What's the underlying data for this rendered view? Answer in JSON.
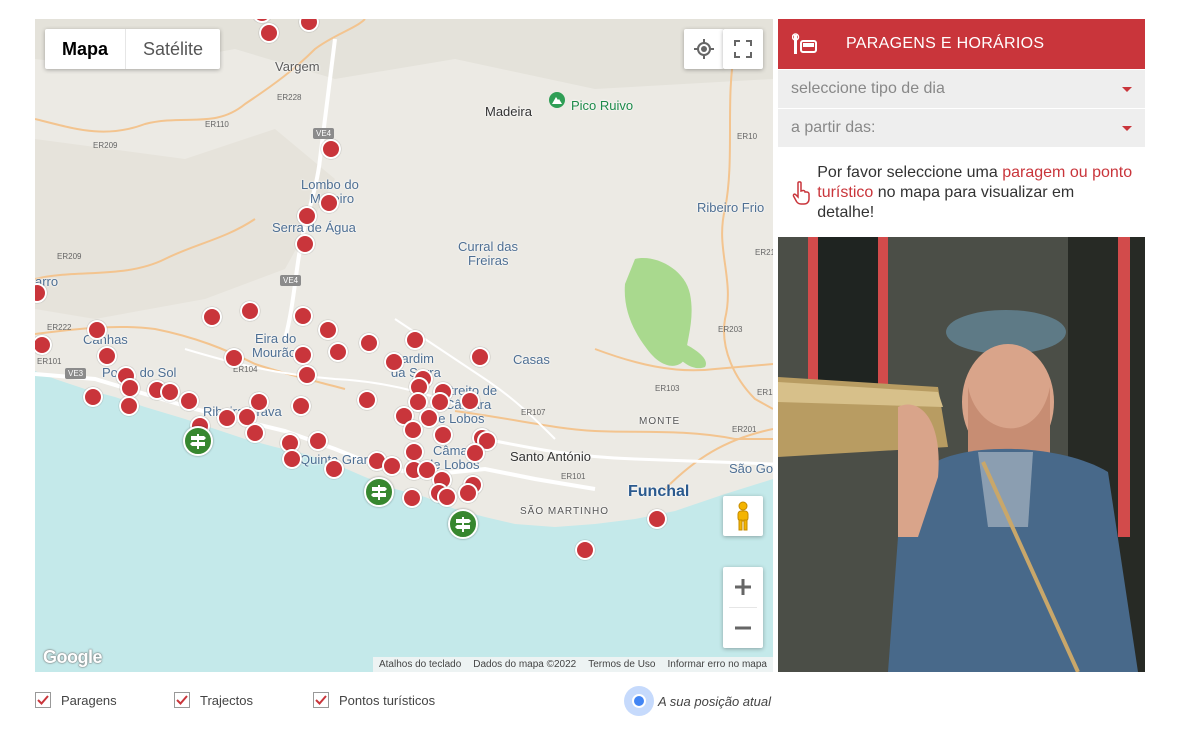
{
  "map": {
    "type_controls": {
      "map_label": "Mapa",
      "satellite_label": "Satélite"
    },
    "places": {
      "vargem": "Vargem",
      "madeira": "Madeira",
      "pico_ruivo": "Pico Ruivo",
      "lombo_do_moreiro_1": "Lombo do",
      "lombo_do_moreiro_2": "Moreiro",
      "serra_de_agua": "Serra de Água",
      "curral_1": "Curral das",
      "curral_2": "Freiras",
      "ribeiro_frio": "Ribeiro Frio",
      "carro": "arro",
      "canhas": "Canhas",
      "ponta_do_sol": "Ponta do Sol",
      "eira_do_mourao_1": "Eira do",
      "eira_do_mourao_2": "Mourão",
      "jardim_1": "Jardim",
      "jardim_2": "da Serra",
      "estreito_1": "Estreito de",
      "estreito_2": "Câmara",
      "estreito_3": "de Lobos",
      "casas": "Casas",
      "ribeira_brava": "Ribeira Brava",
      "quinta_grande": "Quinta Grande",
      "camara_1": "Câmara",
      "camara_2": "de Lobos",
      "santo_antonio": "Santo António",
      "funchal": "Funchal",
      "sao_martinho": "SÃO MARTINHO",
      "monte": "MONTE",
      "sao_go": "São Go"
    },
    "roads": {
      "er228": "ER228",
      "er110": "ER110",
      "er209": "ER209",
      "ve4a": "VE4",
      "ve4b": "VE4",
      "er209b": "ER209",
      "er222": "ER222",
      "er101": "ER101",
      "ve3": "VE3",
      "er104": "ER104",
      "er107": "ER107",
      "er103": "ER103",
      "er203": "ER203",
      "er201": "ER201",
      "er101b": "ER101",
      "er21": "ER21",
      "er10": "ER10",
      "er1": "ER1"
    },
    "attribution": {
      "shortcuts": "Atalhos do teclado",
      "data": "Dados do mapa ©2022",
      "terms": "Termos de Uso",
      "report": "Informar erro no mapa"
    },
    "logo": "Google"
  },
  "panel": {
    "title": "PARAGENS E HORÁRIOS",
    "day_type_placeholder": "seleccione tipo de dia",
    "from_placeholder": "a partir das:",
    "info_prefix": "Por favor seleccione uma ",
    "info_link": "paragem ou ponto turístico",
    "info_suffix": " no mapa para visualizar em detalhe!"
  },
  "legend": {
    "stops": "Paragens",
    "routes": "Trajectos",
    "poi": "Pontos turísticos",
    "position": "A sua posição atual"
  },
  "colors": {
    "accent": "#c9353b",
    "poi": "#37872f",
    "sea": "#c4e9ea"
  }
}
